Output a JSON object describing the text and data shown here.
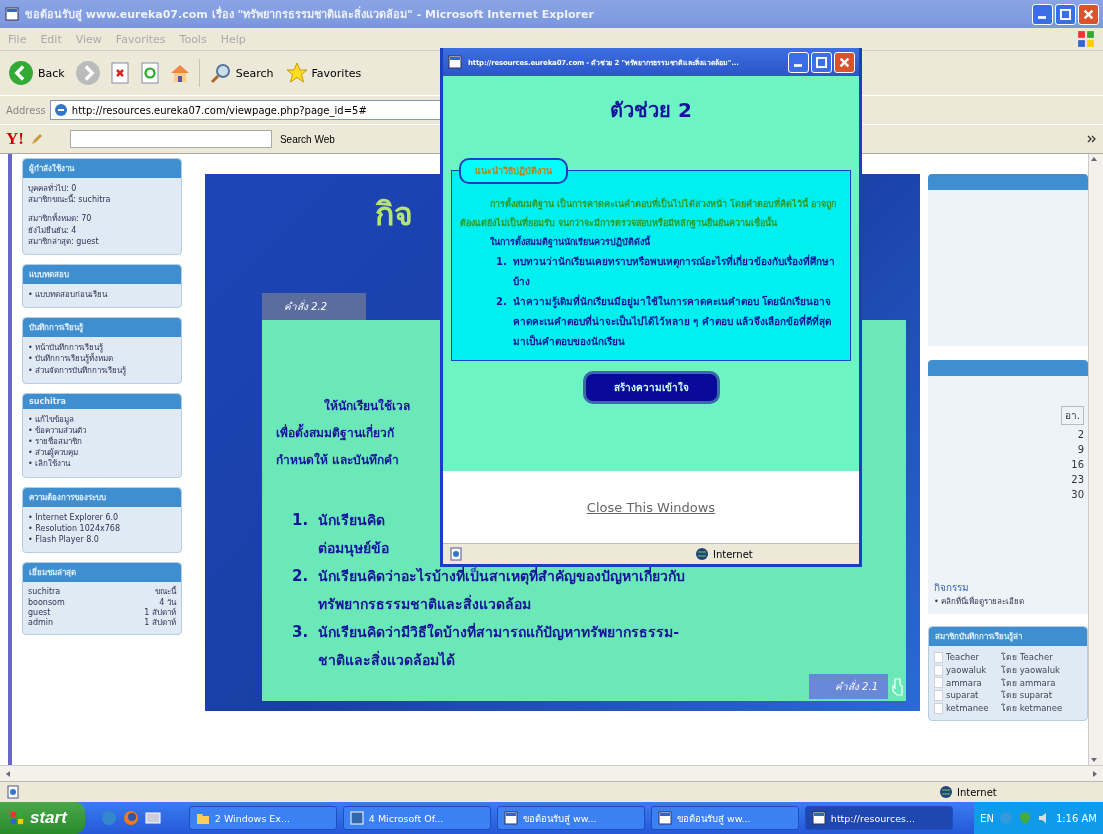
{
  "browser": {
    "title": "ขอต้อนรับสู่ www.eureka07.com เรื่อง \"ทรัพยากรธรรมชาติและสิ่งแวดล้อม\" - Microsoft Internet Explorer",
    "menu": [
      "File",
      "Edit",
      "View",
      "Favorites",
      "Tools",
      "Help"
    ],
    "back": "Back",
    "search": "Search",
    "favorites": "Favorites",
    "address_label": "Address",
    "address": "http://resources.eureka07.com/viewpage.php?page_id=5#",
    "yahoo_logo": "Y!",
    "yahoo_search": "Search Web",
    "status": "Internet"
  },
  "left_panels": [
    {
      "kind": "list",
      "title": "ผู้กำลังใช้งาน",
      "groups": [
        [
          "บุคคลทั่วไป: 0",
          "สมาชิกขณะนี้: suchitra"
        ],
        [
          "สมาชิกทั้งหมด: 70",
          "ยังไม่ยืนยัน: 4",
          "สมาชิกล่าสุด: guest"
        ]
      ]
    },
    {
      "kind": "list",
      "title": "แบบทดสอบ",
      "groups": [
        [
          "• แบบทดสอบก่อนเรียน"
        ]
      ]
    },
    {
      "kind": "list",
      "title": "บันทึกการเรียนรู้",
      "groups": [
        [
          "• หน้าบันทึกการเรียนรู้",
          "• บันทึกการเรียนรู้ทั้งหมด",
          "• ส่วนจัดการบันทึกการเรียนรู้"
        ]
      ]
    },
    {
      "kind": "list",
      "title": "suchitra",
      "groups": [
        [
          "• แก้ไขข้อมูล",
          "• ข้อความส่วนตัว",
          "• รายชื่อสมาชิก",
          "• ส่วนผู้ควบคุม",
          "• เลิกใช้งาน"
        ]
      ]
    },
    {
      "kind": "list",
      "title": "ความต้องการของระบบ",
      "groups": [
        [
          "• Internet Explorer 6.0",
          "• Resolution 1024x768",
          "• Flash Player 8.0"
        ]
      ]
    },
    {
      "kind": "table",
      "title": "เยี่ยมชมล่าสุด",
      "rows": [
        {
          "name": "suchitra",
          "time": "ขณะนี้"
        },
        {
          "name": "boonsom",
          "time": "4 วัน"
        },
        {
          "name": "guest",
          "time": "1 สัปดาห์"
        },
        {
          "name": "admin",
          "time": "1 สัปดาห์"
        }
      ]
    }
  ],
  "slide": {
    "heading": "กิจ",
    "tab": "คำสั่ง 2.2",
    "intro": [
      "ให้นักเรียนใช้เวล",
      "เพื่อตั้งสมมติฐานเกี่ยวกั",
      "กำหนดให้ และบันทึกคำ"
    ],
    "items": [
      {
        "number": "1.",
        "lines": [
          "นักเรียนคิด",
          "ต่อมนุษย์ข้อ"
        ]
      },
      {
        "number": "2.",
        "lines": [
          "นักเรียนคิดว่าอะไรบ้างที่เป็นสาเหตุที่สำคัญของปัญหาเกี่ยวกับ",
          "ทรัพยากรธรรมชาติและสิ่งแวดล้อม"
        ]
      },
      {
        "number": "3.",
        "lines": [
          "นักเรียนคิดว่ามีวิธีใดบ้างที่สามารถแก้ปัญหาทรัพยากรธรรม-",
          "ชาติและสิ่งแวดล้อมได้"
        ]
      }
    ],
    "bottom_tab": "คำสั่ง 2.1"
  },
  "right": {
    "calendar": {
      "header": "อา.",
      "days": [
        "2",
        "9",
        "16",
        "23",
        "30"
      ]
    },
    "activity_title": "กิจกรรม",
    "activity_link": "• คลิกที่นี่เพื่อดูรายละเอียด",
    "recent_title": "สมาชิกบันทึกการเรียนรู้ล่า",
    "recent": [
      {
        "name": "Teacher",
        "by": "โดย Teacher"
      },
      {
        "name": "yaowaluk",
        "by": "โดย yaowaluk"
      },
      {
        "name": "ammara",
        "by": "โดย ammara"
      },
      {
        "name": "suparat",
        "by": "โดย suparat"
      },
      {
        "name": "ketmanee",
        "by": "โดย ketmanee"
      }
    ]
  },
  "popup": {
    "title": "http://resources.eureka07.com - ตัวช่วย 2 \"ทรัพยากรธรรมชาติและสิ่งแวดล้อม\"...",
    "heading": "ตัวช่วย 2",
    "label": "แนะนำวิธีปฏิบัติงาน",
    "paragraph": "การตั้งสมมติฐาน เป็นการคาดคะเนคำตอบที่เป็นไปได้ล่วงหน้า โดยคำตอบที่คิดไว้นี้ อาจถูกต้องแต่ยังไม่เป็นที่ยอมรับ จนกว่าจะมีการตรวจสอบหรือมีหลักฐานยืนยันความเชื่อนั้น",
    "instruction": "ในการตั้งสมมติฐานนักเรียนควรปฏิบัติดังนี้",
    "steps": [
      {
        "number": "1.",
        "text": "ทบทวนว่านักเรียนเคยทราบหรือพบเหตุการณ์อะไรที่เกี่ยวข้องกับเรื่องที่ศึกษาบ้าง"
      },
      {
        "number": "2.",
        "text": "นำความรู้เดิมที่นักเรียนมีอยู่มาใช้ในการคาดคะเนคำตอบ โดยนักเรียนอาจคาดคะเนคำตอบที่น่าจะเป็นไปได้ไว้หลาย ๆ คำตอบ แล้วจึงเลือกข้อที่ดีที่สุดมาเป็นคำตอบของนักเรียน"
      }
    ],
    "button": "สร้างความเข้าใจ",
    "close_link": "Close This Windows",
    "status": "Internet"
  },
  "taskbar": {
    "start": "start",
    "buttons": [
      {
        "kind": "folder",
        "label": "2 Windows Ex...",
        "selected": false
      },
      {
        "kind": "office",
        "label": "4 Microsoft Of...",
        "selected": false
      },
      {
        "kind": "browser",
        "label": "ขอต้อนรับสู่ ww...",
        "selected": false
      },
      {
        "kind": "browser",
        "label": "ขอต้อนรับสู่ ww...",
        "selected": false
      },
      {
        "kind": "browser",
        "label": "http://resources...",
        "selected": true
      }
    ],
    "language": "EN",
    "clock": "1:16 AM"
  }
}
